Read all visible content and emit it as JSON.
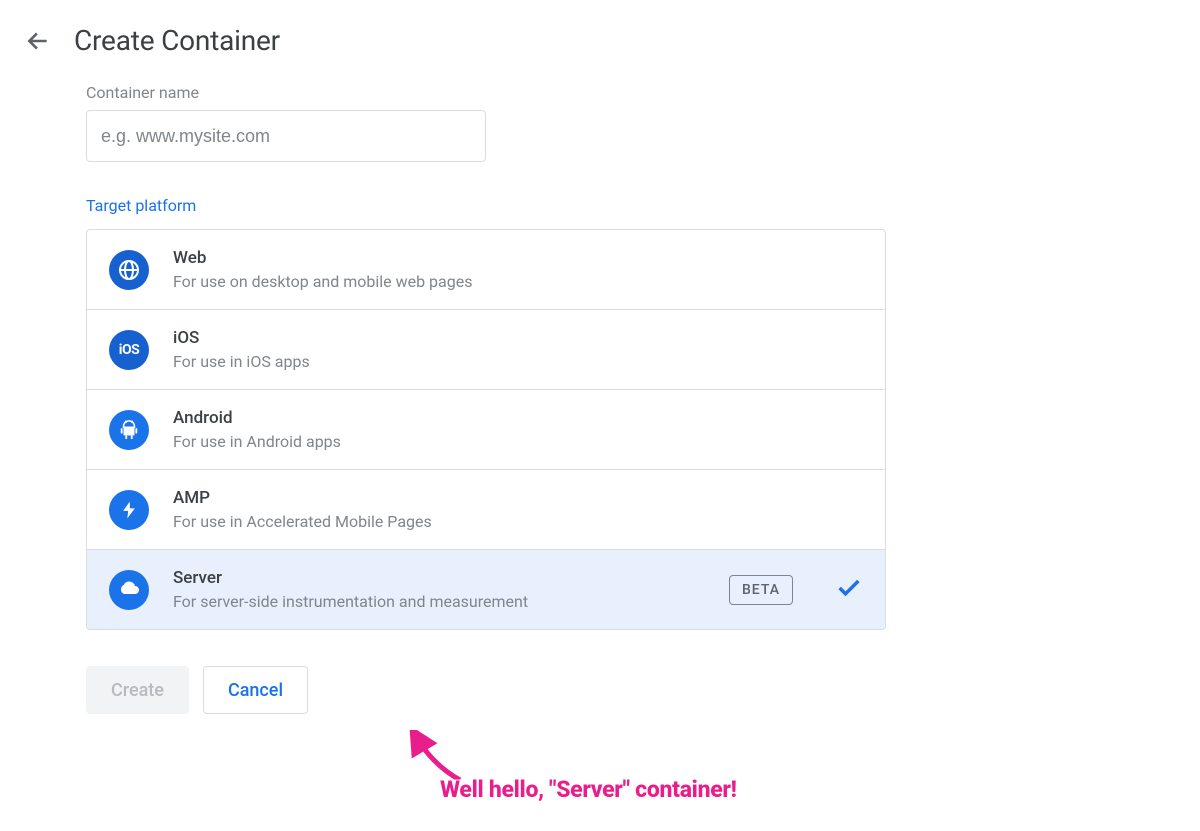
{
  "page_title": "Create Container",
  "container_name": {
    "label": "Container name",
    "placeholder": "e.g. www.mysite.com"
  },
  "target_platform_label": "Target platform",
  "platforms": [
    {
      "title": "Web",
      "desc": "For use on desktop and mobile web pages"
    },
    {
      "title": "iOS",
      "desc": "For use in iOS apps"
    },
    {
      "title": "Android",
      "desc": "For use in Android apps"
    },
    {
      "title": "AMP",
      "desc": "For use in Accelerated Mobile Pages"
    },
    {
      "title": "Server",
      "desc": "For server-side instrumentation and measurement",
      "badge": "BETA",
      "selected": true
    }
  ],
  "buttons": {
    "create": "Create",
    "cancel": "Cancel"
  },
  "annotation_text": "Well hello, \"Server\" container!"
}
